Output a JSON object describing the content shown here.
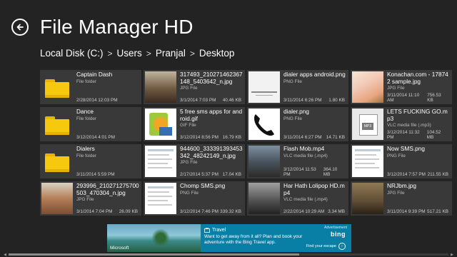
{
  "app": {
    "title": "File Manager HD",
    "back_icon": "back-arrow-icon"
  },
  "breadcrumb": [
    "Local Disk (C:)",
    "Users",
    "Pranjal",
    "Desktop"
  ],
  "breadcrumb_separator": ">",
  "files": [
    {
      "name": "Captain Dash",
      "type": "File folder",
      "date": "2/28/2014 12:03 PM",
      "size": "",
      "thumb": "folder"
    },
    {
      "name": "317493_210271462367148_5403642_n.jpg",
      "type": "JPG File",
      "date": "3/1/2014 7:03 PM",
      "size": "40.46 KB",
      "thumb": "photo1"
    },
    {
      "name": "dialer apps android.png",
      "type": "PNG File",
      "date": "3/11/2014 6:26 PM",
      "size": "1.80 KB",
      "thumb": "white"
    },
    {
      "name": "Konachan.com - 178742 sample.jpg",
      "type": "JPG File",
      "date": "3/11/2014 11:10 AM",
      "size": "756.53 KB",
      "thumb": "anime1"
    },
    {
      "name": "Dance",
      "type": "File folder",
      "date": "3/12/2014 4:01 PM",
      "size": "",
      "thumb": "folder"
    },
    {
      "name": "5 free sms apps for android.gif",
      "type": "GIF File",
      "date": "3/12/2014 8:56 PM",
      "size": "16.79 KB",
      "thumb": "gif"
    },
    {
      "name": "dialer.png",
      "type": "PNG File",
      "date": "3/11/2014 6:27 PM",
      "size": "14.71 KB",
      "thumb": "phone"
    },
    {
      "name": "LETS FUCKING GO.mp3",
      "type": "VLC media file (.mp3)",
      "date": "3/12/2014 11:32 PM",
      "size": "104.52 MB",
      "thumb": "mp3"
    },
    {
      "name": "Dialers",
      "type": "File folder",
      "date": "3/11/2014 5:59 PM",
      "size": "",
      "thumb": "folder"
    },
    {
      "name": "944600_333391393453342_48242149_n.jpg",
      "type": "JPG File",
      "date": "2/17/2014 5:37 PM",
      "size": "17.04 KB",
      "thumb": "sms"
    },
    {
      "name": "Flash Mob.mp4",
      "type": "VLC media file (.mp4)",
      "date": "3/12/2014 11:53 PM",
      "size": "364.10 MB",
      "thumb": "mob"
    },
    {
      "name": "Now SMS.png",
      "type": "PNG File",
      "date": "3/12/2014 7:57 PM",
      "size": "211.55 KB",
      "thumb": "sms"
    },
    {
      "name": "293996_210271275700503_470304_n.jpg",
      "type": "JPG File",
      "date": "3/1/2014 7:04 PM",
      "size": "26.09 KB",
      "thumb": "photo2"
    },
    {
      "name": "Chomp SMS.png",
      "type": "PNG File",
      "date": "3/12/2014 7:46 PM",
      "size": "339.32 KB",
      "thumb": "sms"
    },
    {
      "name": "Har Hath Lolipop HD.mp4",
      "type": "VLC media file (.mp4)",
      "date": "2/22/2014 10:29 AM",
      "size": "3.34 MB",
      "thumb": "mp4b"
    },
    {
      "name": "NRJbm.jpg",
      "type": "JPG File",
      "date": "3/11/2014 9:39 PM",
      "size": "517.21 KB",
      "thumb": "nr"
    }
  ],
  "ad": {
    "label": "Advertisement",
    "brand": "bing",
    "sponsor": "Microsoft",
    "heading": "Travel",
    "text": "Want to get away from it all? Plan and book your adventure with the Bing Travel app.",
    "cta": "Find your escape"
  },
  "scroll": {
    "position": 0.66
  }
}
